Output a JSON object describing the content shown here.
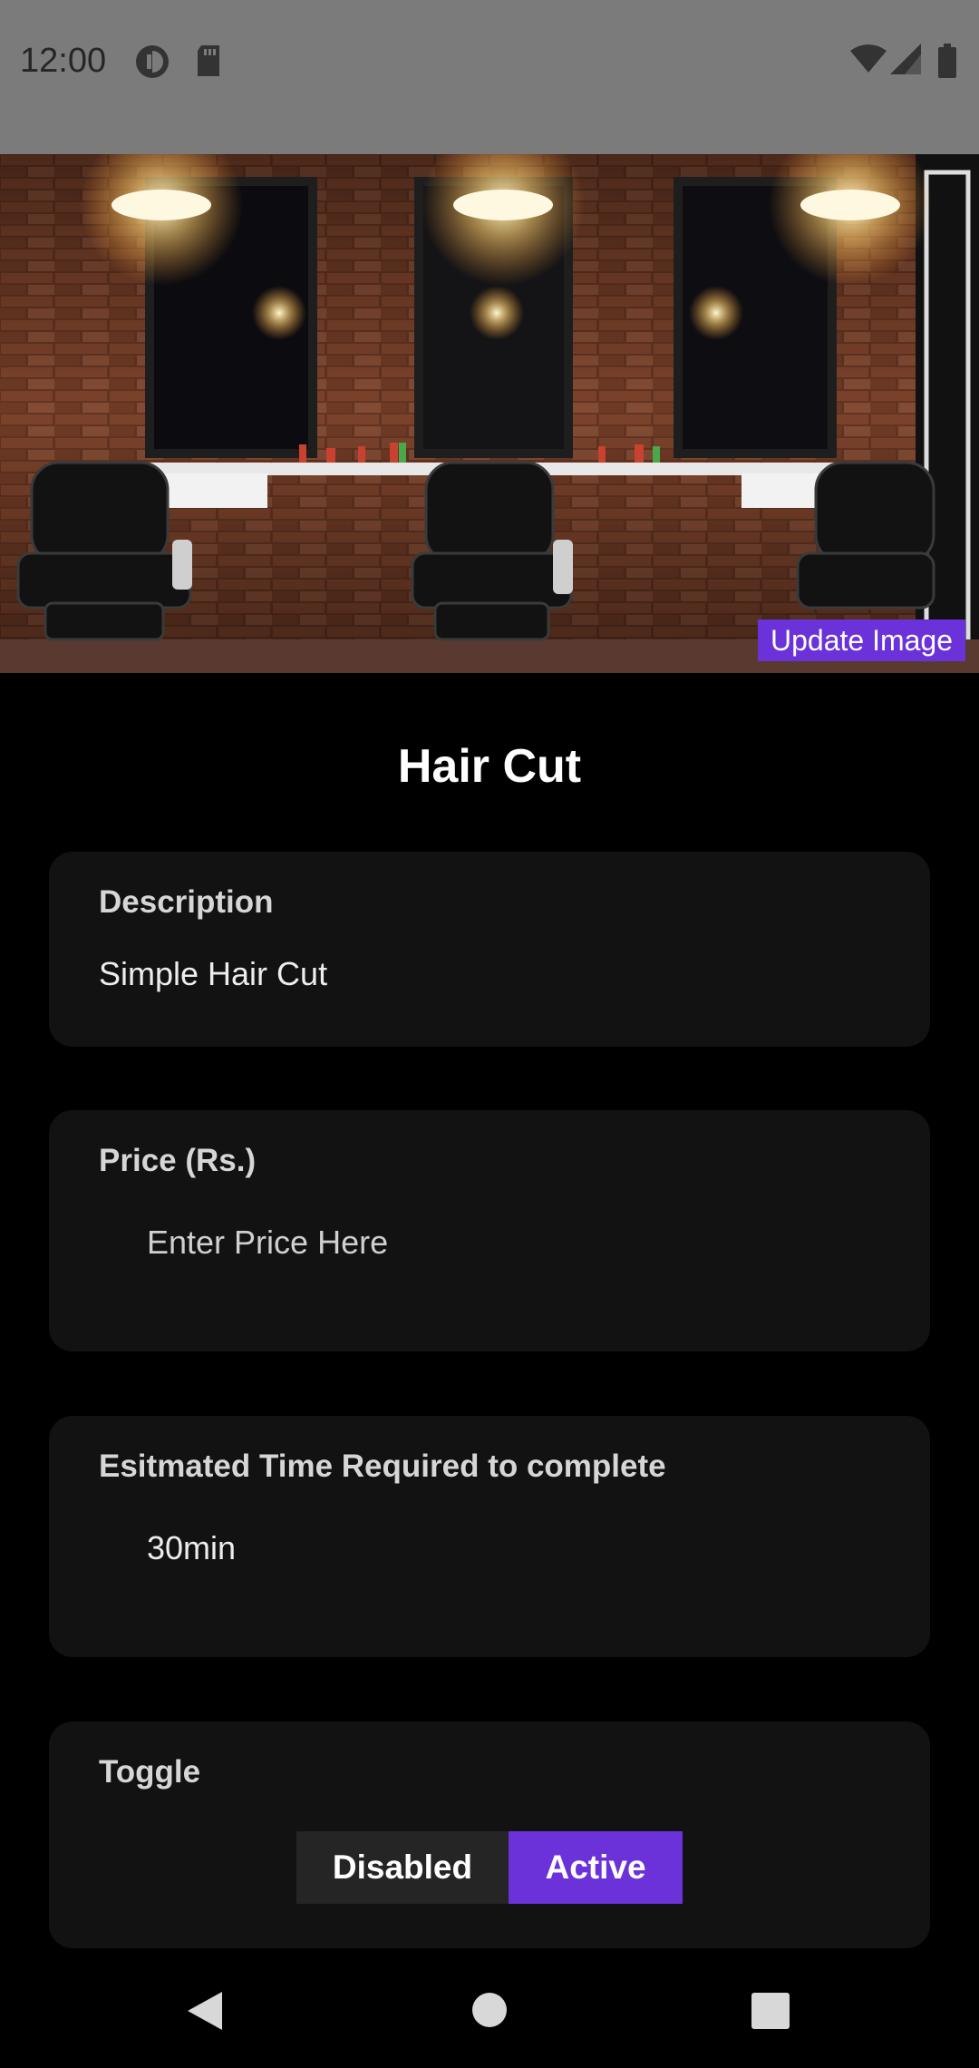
{
  "status_bar": {
    "time": "12:00",
    "left_icons": [
      "data-saver-icon",
      "sd-card-icon"
    ],
    "right_icons": [
      "wifi-icon",
      "cellular-signal-icon",
      "battery-icon"
    ]
  },
  "hero": {
    "image_subject": "barber shop interior with three barber chairs, mirrors and hanging lamps",
    "update_button_label": "Update Image"
  },
  "service": {
    "title": "Hair Cut"
  },
  "description_card": {
    "label": "Description",
    "value": "Simple Hair Cut"
  },
  "price_card": {
    "label": "Price (Rs.)",
    "placeholder": "Enter Price Here"
  },
  "time_card": {
    "label": "Esitmated Time Required to complete",
    "value": "30min"
  },
  "toggle_card": {
    "label": "Toggle",
    "options": [
      "Disabled",
      "Active"
    ],
    "selected": "Active"
  },
  "nav_bar": {
    "buttons": [
      "back-icon",
      "home-icon",
      "recents-icon"
    ]
  },
  "colors": {
    "accent": "#6a32d8",
    "card_bg": "#121212",
    "status_bar_bg": "#7b7b7b",
    "page_bg": "#000000"
  }
}
